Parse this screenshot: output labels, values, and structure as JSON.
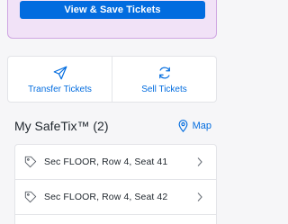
{
  "promo": {
    "button_label": "View & Save Tickets"
  },
  "actions": [
    {
      "label": "Transfer Tickets",
      "icon": "paper-plane-icon"
    },
    {
      "label": "Sell Tickets",
      "icon": "refresh-icon"
    }
  ],
  "safetix": {
    "title": "My SafeTix™",
    "count": "(2)",
    "map_label": "Map",
    "tickets": [
      {
        "label": "Sec FLOOR, Row 4, Seat 41"
      },
      {
        "label": "Sec FLOOR, Row 4, Seat 42"
      }
    ]
  },
  "colors": {
    "accent": "#026cdf",
    "promo_bg": "#f1e2f7",
    "promo_border": "#cfa6e2"
  }
}
